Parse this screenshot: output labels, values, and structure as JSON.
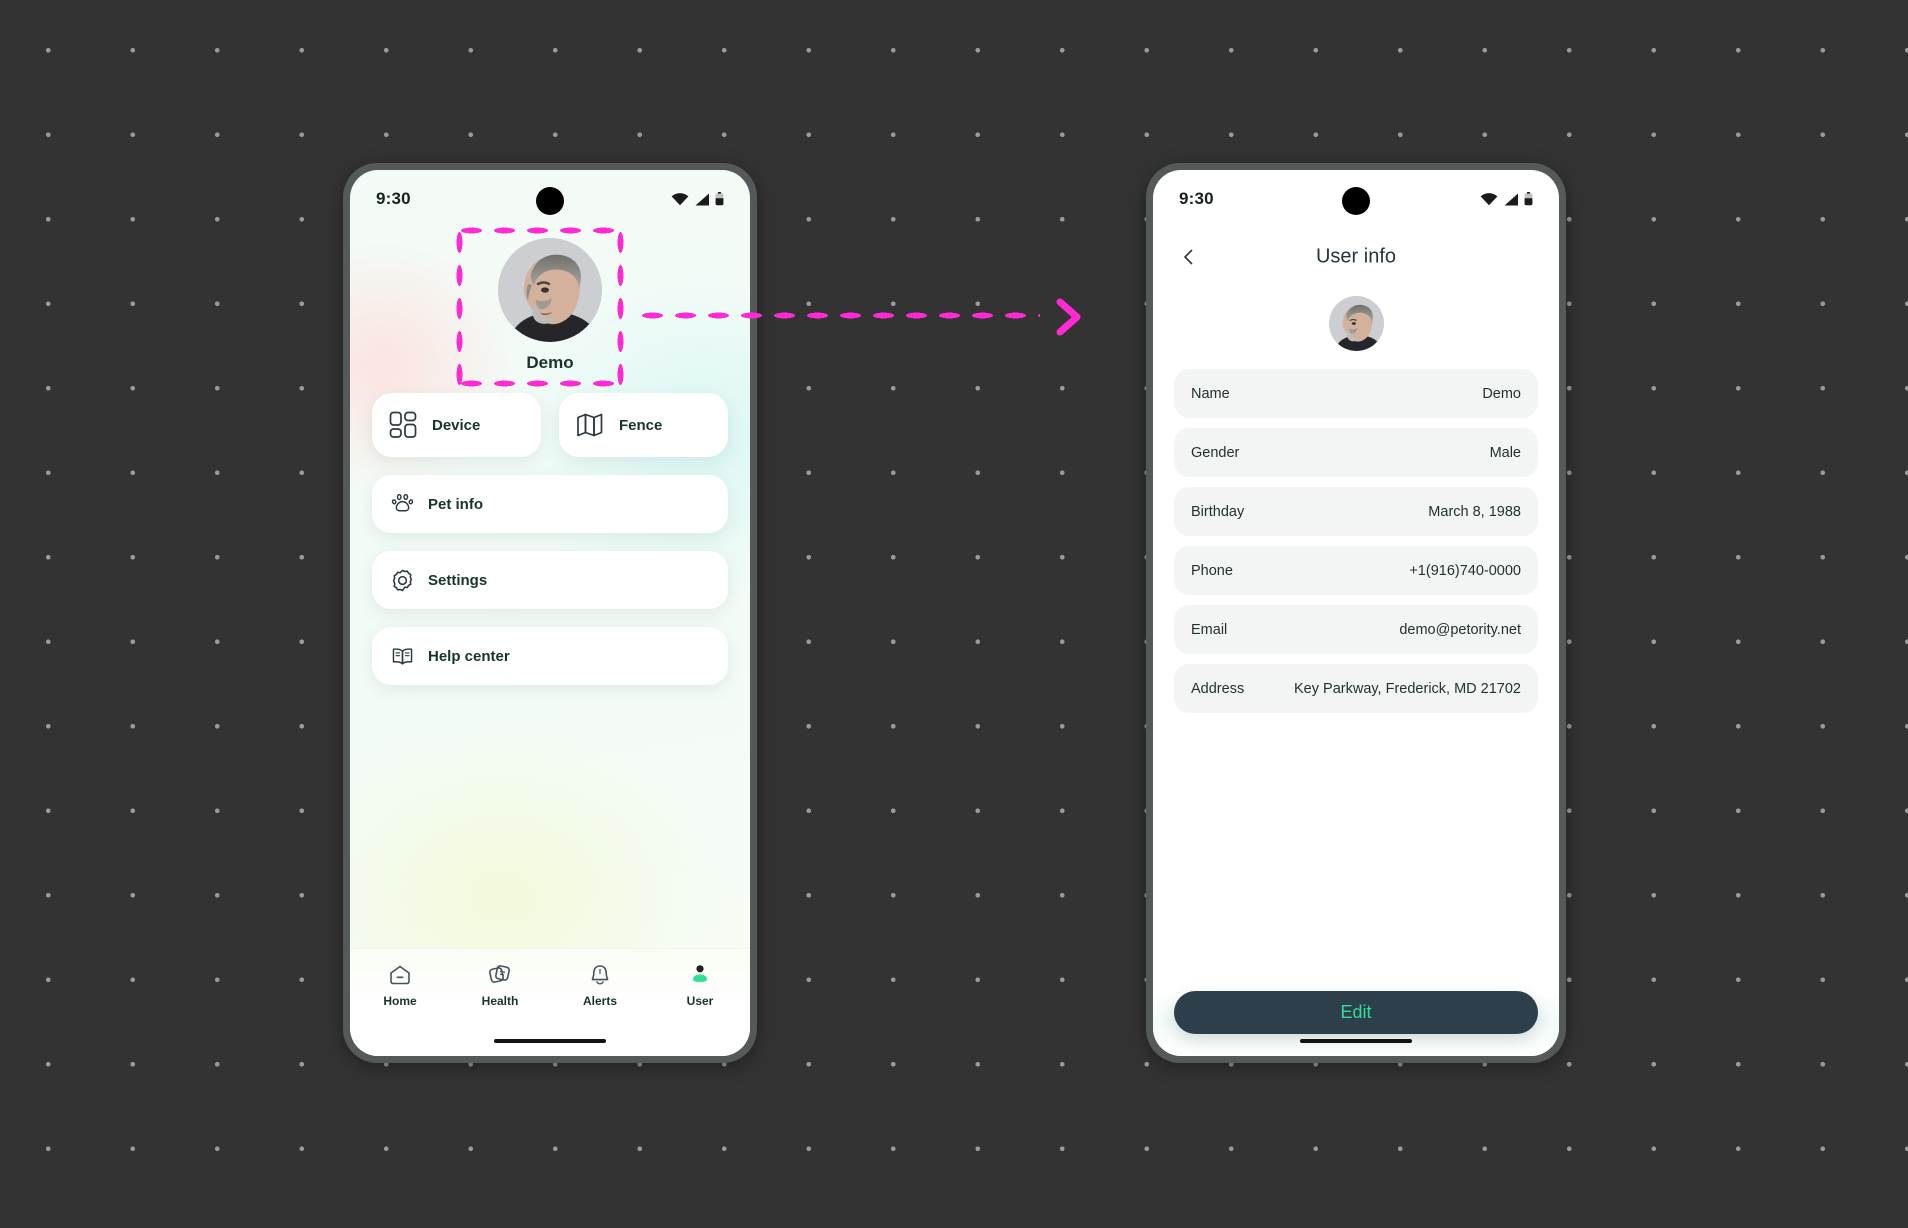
{
  "theme": {
    "canvas_bg": "#333333",
    "dot_color": "#9a9a9a",
    "connector_color": "#ff2ad4",
    "accent_green": "#2ee08f",
    "dark_slate": "#2e3f4c",
    "text_dark": "#17352c"
  },
  "home_screen": {
    "status_bar": {
      "time": "9:30",
      "icons": [
        "wifi-icon",
        "cellular-signal-icon",
        "battery-icon"
      ]
    },
    "profile": {
      "name": "Demo",
      "avatar": "user-avatar-photo",
      "selected": true
    },
    "quick_cards": [
      {
        "label": "Device",
        "icon": "grid-squares-icon"
      },
      {
        "label": "Fence",
        "icon": "map-icon"
      }
    ],
    "menu_rows": [
      {
        "label": "Pet info",
        "icon": "paw-print-icon"
      },
      {
        "label": "Settings",
        "icon": "gear-icon"
      },
      {
        "label": "Help center",
        "icon": "open-book-icon"
      }
    ],
    "bottom_nav": {
      "active": "User",
      "items": [
        {
          "label": "Home",
          "icon": "home-icon",
          "active": false
        },
        {
          "label": "Health",
          "icon": "health-cards-icon",
          "active": false
        },
        {
          "label": "Alerts",
          "icon": "bell-icon",
          "active": false
        },
        {
          "label": "User",
          "icon": "person-icon",
          "active": true
        }
      ]
    }
  },
  "detail_screen": {
    "status_bar": {
      "time": "9:30",
      "icons": [
        "wifi-icon",
        "cellular-signal-icon",
        "battery-icon"
      ]
    },
    "header": {
      "title": "User info",
      "back_icon": "chevron-left-icon"
    },
    "avatar": "user-avatar-photo",
    "info_rows": [
      {
        "label": "Name",
        "value": "Demo"
      },
      {
        "label": "Gender",
        "value": "Male"
      },
      {
        "label": "Birthday",
        "value": "March 8, 1988"
      },
      {
        "label": "Phone",
        "value": "+1(916)740-0000"
      },
      {
        "label": "Email",
        "value": "demo@petority.net"
      },
      {
        "label": "Address",
        "value": "Key Parkway, Frederick, MD 21702"
      }
    ],
    "edit_button": "Edit"
  },
  "connector": {
    "style": "dotted-arrow",
    "color": "#ff2ad4",
    "from": "profile-avatar",
    "to": "user-info-screen"
  }
}
